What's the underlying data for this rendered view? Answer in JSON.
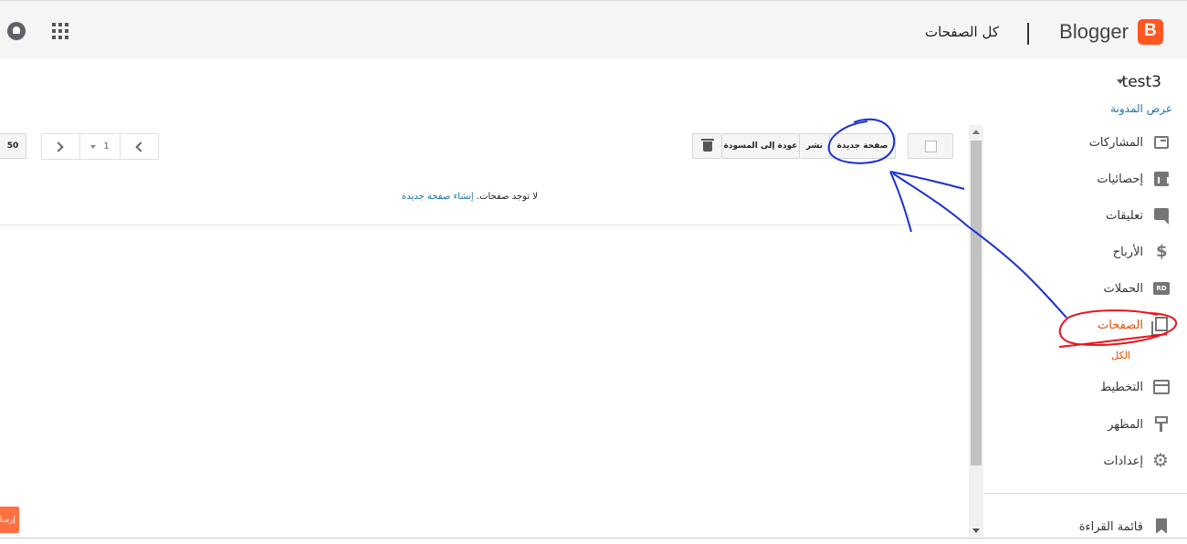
{
  "header": {
    "brand_name": "Blogger",
    "brand_letter": "B",
    "page_title": "كل الصفحات"
  },
  "sidebar": {
    "blog_name": "test3",
    "view_blog": "عرض المدونة",
    "items": [
      {
        "label": "المشاركات",
        "icon": "posts-icon"
      },
      {
        "label": "إحصائيات",
        "icon": "stats-icon"
      },
      {
        "label": "تعليقات",
        "icon": "comments-icon"
      },
      {
        "label": "الأرباح",
        "icon": "dollar-icon"
      },
      {
        "label": "الحملات",
        "icon": "campaigns-icon"
      },
      {
        "label": "الصفحات",
        "icon": "pages-icon"
      },
      {
        "label": "التخطيط",
        "icon": "layout-icon"
      },
      {
        "label": "المظهر",
        "icon": "theme-icon"
      },
      {
        "label": "إعدادات",
        "icon": "gear-icon"
      }
    ],
    "campaigns_icon_text": "RD",
    "active_sub_item": "الكل",
    "reading_list": "قائمة القراءة"
  },
  "toolbar": {
    "new_page": "صفحة جديدة",
    "publish": "نشر",
    "revert_to_draft": "عودة إلى المسودة",
    "page_number": "1",
    "page_size": "50"
  },
  "content": {
    "empty_text": "لا توجد صفحات.",
    "create_link": "إنشاء صفحة جديدة"
  },
  "feedback": {
    "label": "إرسال"
  },
  "colors": {
    "brand": "#ff5722",
    "active": "#e65100",
    "link": "#1a73a8",
    "annotation_blue": "#1a2fd0",
    "annotation_red": "#e8141c"
  }
}
